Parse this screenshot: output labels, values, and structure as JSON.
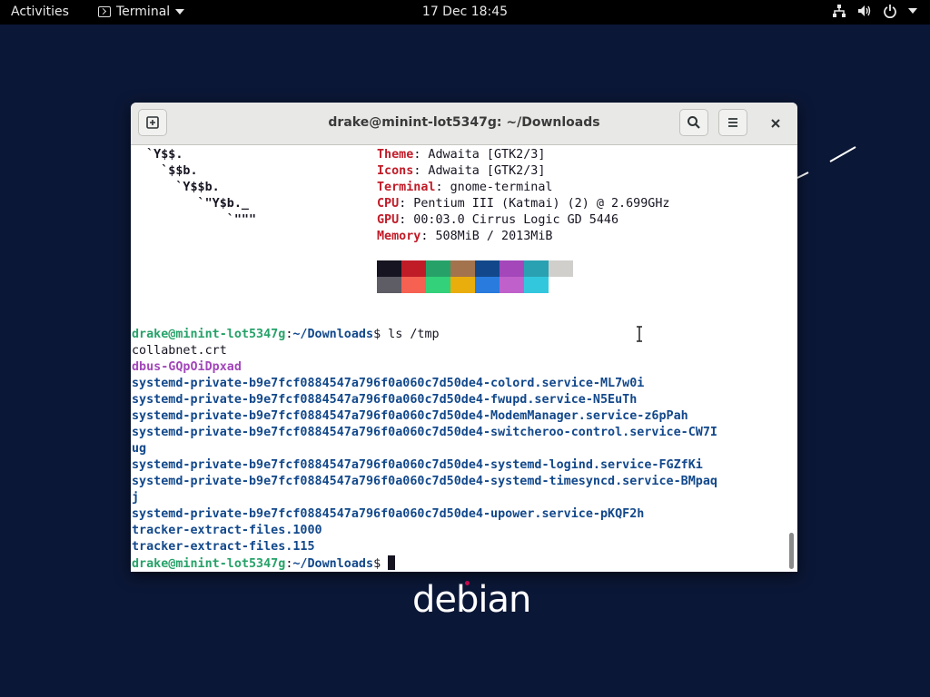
{
  "topbar": {
    "activities": "Activities",
    "app_name": "Terminal",
    "clock": "17 Dec  18:45"
  },
  "window": {
    "title": "drake@minint-lot5347g: ~/Downloads"
  },
  "ascii_art": [
    "  `Y$$.",
    "    `$$b.",
    "      `Y$$b.",
    "         `\"Y$b._",
    "             `\"\"\""
  ],
  "sysinfo": [
    {
      "key": "Theme",
      "value": ": Adwaita [GTK2/3]"
    },
    {
      "key": "Icons",
      "value": ": Adwaita [GTK2/3]"
    },
    {
      "key": "Terminal",
      "value": ": gnome-terminal"
    },
    {
      "key": "CPU",
      "value": ": Pentium III (Katmai) (2) @ 2.699GHz"
    },
    {
      "key": "GPU",
      "value": ": 00:03.0 Cirrus Logic GD 5446"
    },
    {
      "key": "Memory",
      "value": ": 508MiB / 2013MiB"
    }
  ],
  "palette": {
    "row1": [
      "#171421",
      "#c01c28",
      "#26a269",
      "#a2734c",
      "#12488b",
      "#a347ba",
      "#2aa1b3",
      "#d0cfcc"
    ],
    "row2": [
      "#5e5c64",
      "#f66151",
      "#33d17a",
      "#e9ad0c",
      "#2a7bde",
      "#c061cb",
      "#33c7de",
      "#ffffff"
    ]
  },
  "prompt": {
    "user_host": "drake@minint-lot5347g",
    "path": "~/Downloads",
    "symbol": "$",
    "command": " ls /tmp"
  },
  "ls_output": [
    {
      "text": "collabnet.crt",
      "style": "plain"
    },
    {
      "text": "dbus-GQpOiDpxad",
      "style": "mag"
    },
    {
      "text": "systemd-private-b9e7fcf0884547a796f0a060c7d50de4-colord.service-ML7w0i",
      "style": "blue"
    },
    {
      "text": "systemd-private-b9e7fcf0884547a796f0a060c7d50de4-fwupd.service-N5EuTh",
      "style": "blue"
    },
    {
      "text": "systemd-private-b9e7fcf0884547a796f0a060c7d50de4-ModemManager.service-z6pPah",
      "style": "blue"
    },
    {
      "text": "systemd-private-b9e7fcf0884547a796f0a060c7d50de4-switcheroo-control.service-CW7I",
      "style": "blue"
    },
    {
      "text": "ug",
      "style": "blue"
    },
    {
      "text": "systemd-private-b9e7fcf0884547a796f0a060c7d50de4-systemd-logind.service-FGZfKi",
      "style": "blue"
    },
    {
      "text": "systemd-private-b9e7fcf0884547a796f0a060c7d50de4-systemd-timesyncd.service-BMpaq",
      "style": "blue"
    },
    {
      "text": "j",
      "style": "blue"
    },
    {
      "text": "systemd-private-b9e7fcf0884547a796f0a060c7d50de4-upower.service-pKQF2h",
      "style": "blue"
    },
    {
      "text": "tracker-extract-files.1000",
      "style": "blue"
    },
    {
      "text": "tracker-extract-files.115",
      "style": "blue"
    }
  ],
  "desktop": {
    "logo_text": "debian"
  },
  "icons": {
    "new_tab": "new-tab-icon",
    "search": "search-icon",
    "menu": "hamburger-menu-icon",
    "close": "close-icon",
    "network": "network-icon",
    "volume": "volume-icon",
    "power": "power-icon"
  }
}
